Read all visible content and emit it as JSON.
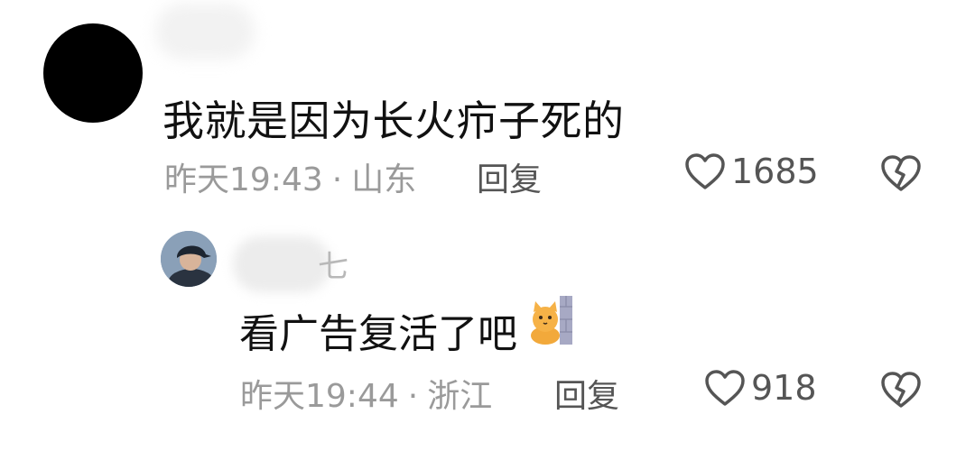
{
  "comments": [
    {
      "text": "我就是因为长火疖子死的",
      "time": "昨天19:43",
      "separator": "·",
      "location": "山东",
      "reply_label": "回复",
      "likes": "1685",
      "avatar": {
        "icon": "black-circle-avatar",
        "color": "#000000"
      }
    },
    {
      "username_partial": "七",
      "text": "看广告复活了吧",
      "emoji_icon": "cat-peeking-emoji",
      "time": "昨天19:44",
      "separator": "·",
      "location": "浙江",
      "reply_label": "回复",
      "likes": "918",
      "avatar": {
        "icon": "person-cap-avatar",
        "color": "#7d94ad"
      }
    }
  ],
  "icons": {
    "like": "heart-outline-icon",
    "dislike": "broken-heart-outline-icon"
  },
  "colors": {
    "text_primary": "#111111",
    "text_meta": "#9a9a9a",
    "text_action": "#555555"
  }
}
